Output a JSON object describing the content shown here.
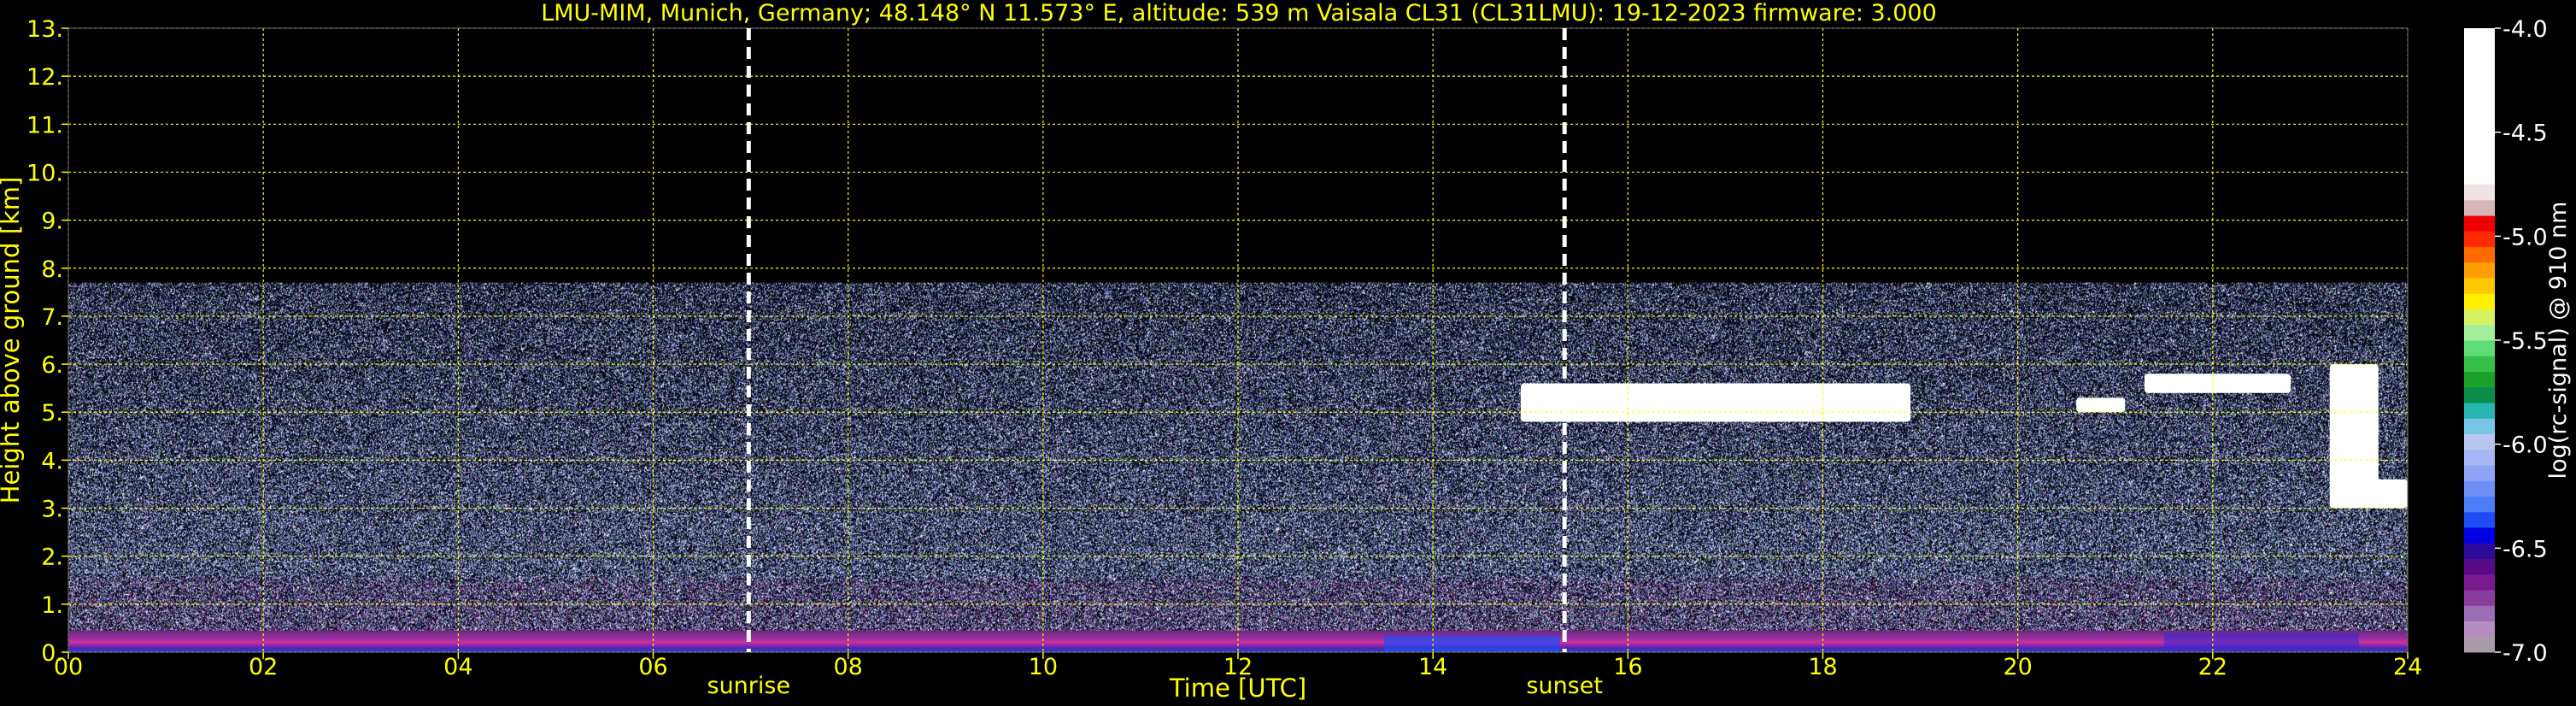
{
  "chart_data": {
    "type": "heatmap",
    "title": "LMU-MIM, Munich, Germany; 48.148° N 11.573° E, altitude: 539 m    Vaisala CL31 (CL31LMU): 19-12-2023    firmware: 3.000",
    "xlabel": "Time [UTC]",
    "ylabel": "Height above ground [km]",
    "xlim": [
      0,
      24
    ],
    "ylim": [
      0,
      13
    ],
    "x_ticks": [
      "00",
      "02",
      "04",
      "06",
      "08",
      "10",
      "12",
      "14",
      "16",
      "18",
      "20",
      "22",
      "24"
    ],
    "y_ticks": [
      "0.",
      "1.",
      "2.",
      "3.",
      "4.",
      "5.",
      "6.",
      "7.",
      "8.",
      "9.",
      "10.",
      "11.",
      "12.",
      "13."
    ],
    "grid": true,
    "max_signal_height_km": 7.7,
    "events": [
      {
        "label": "sunrise",
        "time_h": 6.98
      },
      {
        "label": "sunset",
        "time_h": 15.35
      }
    ],
    "cloud_layers": [
      {
        "t_start": 14.9,
        "t_end": 18.9,
        "h_bottom": 4.8,
        "h_top": 5.6
      },
      {
        "t_start": 20.6,
        "t_end": 21.1,
        "h_bottom": 5.0,
        "h_top": 5.3
      },
      {
        "t_start": 21.3,
        "t_end": 22.8,
        "h_bottom": 5.4,
        "h_top": 5.8
      },
      {
        "t_start": 23.2,
        "t_end": 23.7,
        "h_bottom": 3.0,
        "h_top": 6.0
      },
      {
        "t_start": 23.4,
        "t_end": 24.0,
        "h_bottom": 3.0,
        "h_top": 3.6
      }
    ],
    "colorbar": {
      "label": "log(rc-signal) @ 910 nm",
      "ticks": [
        "-4.0",
        "-4.5",
        "-5.0",
        "-5.5",
        "-6.0",
        "-6.5",
        "-7.0"
      ],
      "range": [
        -7.0,
        -4.0
      ],
      "colors": [
        "#a99aaa",
        "#b48cc0",
        "#9b6db5",
        "#8a3c9c",
        "#7a1990",
        "#5a0a88",
        "#2d0a9a",
        "#0000e0",
        "#1e4cf5",
        "#4a7df7",
        "#6f8ff7",
        "#8ea4f7",
        "#a7b6f4",
        "#b7c6ef",
        "#79c5e8",
        "#26b5b0",
        "#0a8d4a",
        "#19a22a",
        "#36c04a",
        "#5fdc76",
        "#a4ee9c",
        "#d4f262",
        "#fff000",
        "#ffc800",
        "#ff9e00",
        "#ff6a00",
        "#ff2a00",
        "#ee0000",
        "#d8b6b8",
        "#efe3e4",
        "#ffffff"
      ]
    }
  }
}
